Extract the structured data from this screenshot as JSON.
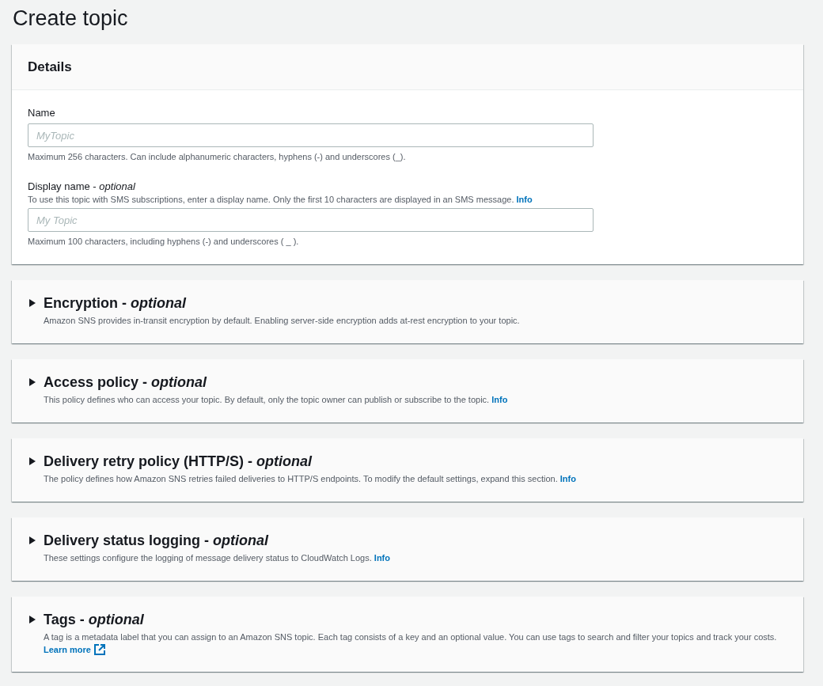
{
  "page_title": "Create topic",
  "details": {
    "title": "Details",
    "fields": [
      {
        "label": "Name",
        "placeholder": "MyTopic",
        "constraint": "Maximum 256 characters. Can include alphanumeric characters, hyphens (-) and underscores (_)."
      },
      {
        "label": "Display name - *optional*",
        "hint_above": {
          "text": "To use this topic with SMS subscriptions, enter a display name. Only the first 10 characters are displayed in an SMS message.",
          "link": "Info"
        },
        "placeholder": "My Topic",
        "constraint": "Maximum 100 characters, including hyphens (-) and underscores ( _ )."
      }
    ]
  },
  "sections": [
    {
      "title": "Encryption - *optional*",
      "expanded": false,
      "description": "Amazon SNS provides in-transit encryption by default. Enabling server-side encryption adds at-rest encryption to your topic."
    },
    {
      "title": "Access policy - *optional*",
      "expanded": false,
      "description": "This policy defines who can access your topic. By default, only the topic owner can publish or subscribe to the topic.",
      "link": {
        "text": "Info",
        "external": false
      }
    },
    {
      "title": "Delivery retry policy (HTTP/S) - *optional*",
      "expanded": false,
      "description": "The policy defines how Amazon SNS retries failed deliveries to HTTP/S endpoints. To modify the default settings, expand this section.",
      "link": {
        "text": "Info",
        "external": false
      }
    },
    {
      "title": "Delivery status logging - *optional*",
      "expanded": false,
      "description": "These settings configure the logging of message delivery status to CloudWatch Logs.",
      "link": {
        "text": "Info",
        "external": false
      }
    },
    {
      "title": "Tags - *optional*",
      "expanded": false,
      "description": "A tag is a metadata label that you can assign to an Amazon SNS topic. Each tag consists of a key and an optional value. You can use tags to search and filter your topics and track your costs.",
      "link": {
        "text": "Learn more",
        "external": true
      }
    }
  ]
}
